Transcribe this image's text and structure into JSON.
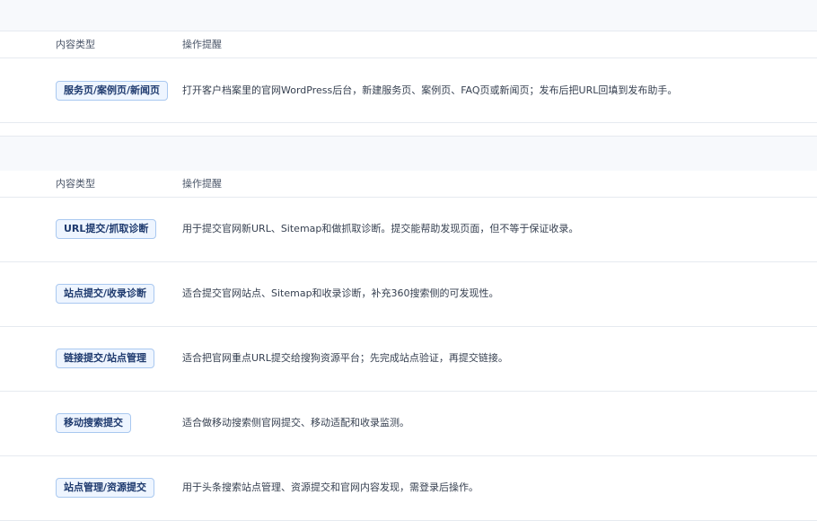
{
  "section1": {
    "header": {
      "type_label": "内容类型",
      "tip_label": "操作提醒"
    },
    "rows": [
      {
        "type": "服务页/案例页/新闻页",
        "tip": "打开客户档案里的官网WordPress后台，新建服务页、案例页、FAQ页或新闻页；发布后把URL回填到发布助手。"
      }
    ]
  },
  "section2": {
    "header": {
      "type_label": "内容类型",
      "tip_label": "操作提醒"
    },
    "rows": [
      {
        "type": "URL提交/抓取诊断",
        "tip": "用于提交官网新URL、Sitemap和做抓取诊断。提交能帮助发现页面，但不等于保证收录。"
      },
      {
        "type": "站点提交/收录诊断",
        "tip": "适合提交官网站点、Sitemap和收录诊断，补充360搜索侧的可发现性。"
      },
      {
        "type": "链接提交/站点管理",
        "tip": "适合把官网重点URL提交给搜狗资源平台；先完成站点验证，再提交链接。"
      },
      {
        "type": "移动搜索提交",
        "tip": "适合做移动搜索侧官网提交、移动适配和收录监测。"
      },
      {
        "type": "站点管理/资源提交",
        "tip": "用于头条搜索站点管理、资源提交和官网内容发现，需登录后操作。"
      }
    ]
  }
}
